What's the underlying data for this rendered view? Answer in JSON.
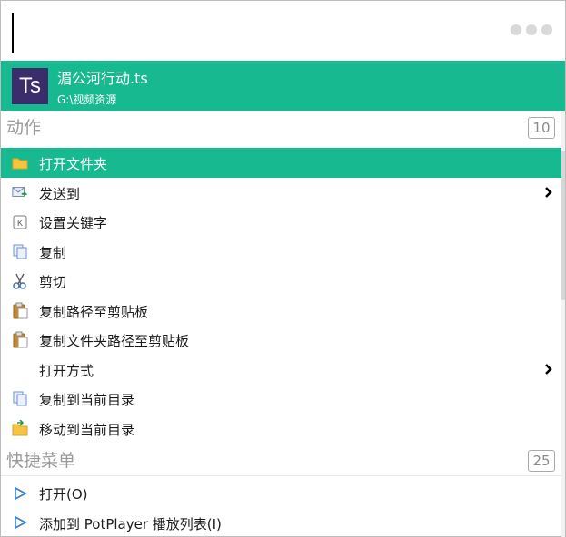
{
  "search": {
    "value": ""
  },
  "file": {
    "icon_text": "Ts",
    "name": "湄公河行动.ts",
    "path": "G:\\视频资源"
  },
  "actions_section": {
    "title": "动作",
    "count": "10"
  },
  "actions": [
    {
      "label": "打开文件夹",
      "icon": "folder-icon",
      "active": true,
      "submenu": false
    },
    {
      "label": "发送到",
      "icon": "send-mail-icon",
      "active": false,
      "submenu": true
    },
    {
      "label": "设置关键字",
      "icon": "keyword-icon",
      "active": false,
      "submenu": false
    },
    {
      "label": "复制",
      "icon": "copy-icon",
      "active": false,
      "submenu": false
    },
    {
      "label": "剪切",
      "icon": "scissors-icon",
      "active": false,
      "submenu": false
    },
    {
      "label": "复制路径至剪贴板",
      "icon": "clipboard-icon",
      "active": false,
      "submenu": false
    },
    {
      "label": "复制文件夹路径至剪贴板",
      "icon": "clipboard-icon",
      "active": false,
      "submenu": false
    },
    {
      "label": "打开方式",
      "icon": "",
      "active": false,
      "submenu": true
    },
    {
      "label": "复制到当前目录",
      "icon": "copy-icon",
      "active": false,
      "submenu": false
    },
    {
      "label": "移动到当前目录",
      "icon": "move-icon",
      "active": false,
      "submenu": false
    }
  ],
  "quick_section": {
    "title": "快捷菜单",
    "count": "25"
  },
  "quick_menu": [
    {
      "label": "打开(O)",
      "icon": "play-triangle-icon"
    },
    {
      "label": "添加到 PotPlayer 播放列表(I)",
      "icon": "play-triangle-icon"
    }
  ],
  "colors": {
    "accent": "#17b990",
    "file_icon_bg": "#3b2d6b",
    "section_text": "#9a9a9a"
  }
}
